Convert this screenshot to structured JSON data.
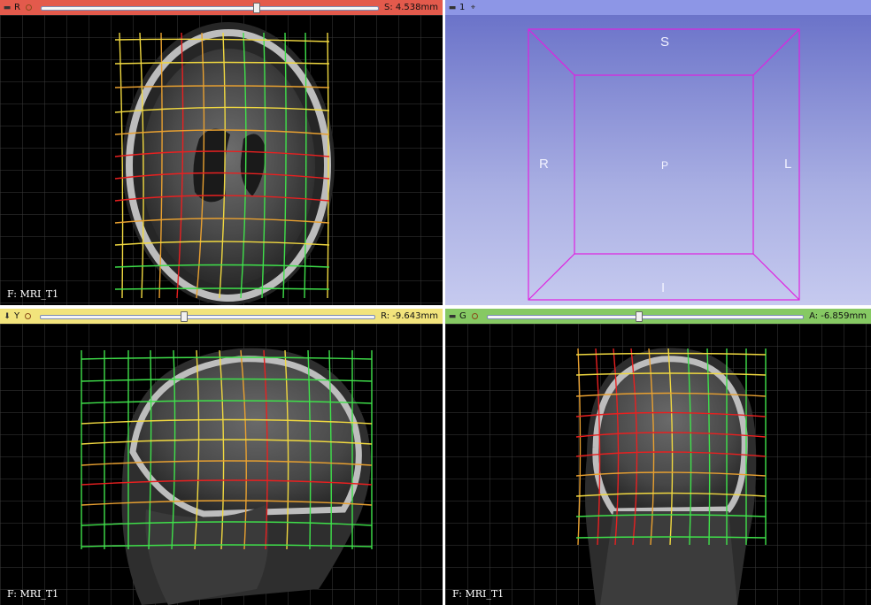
{
  "views": {
    "red": {
      "label": "R",
      "slice_offset": "S: 4.538mm",
      "slider_value": 0.64,
      "foreground": "F: MRI_T1",
      "color": "#e35a4c"
    },
    "threeD": {
      "label": "1",
      "color": "#8d96e6",
      "orientation": {
        "superior": "S",
        "inferior": "I",
        "right": "R",
        "left": "L",
        "posterior": "P"
      }
    },
    "yellow": {
      "label": "Y",
      "slice_offset": "R: -9.643mm",
      "slider_value": 0.43,
      "foreground": "F: MRI_T1",
      "color": "#f2e47c"
    },
    "green": {
      "label": "G",
      "slice_offset": "A: -6.859mm",
      "slider_value": 0.48,
      "foreground": "F: MRI_T1",
      "color": "#86c963"
    }
  },
  "icons": {
    "pin": "pin-icon",
    "link": "link-icon",
    "view_center": "crosshair-icon"
  },
  "colors": {
    "grid_line": "#3b3b3b",
    "warp_low": "#3fe04a",
    "warp_mid": "#f0d840",
    "warp_high": "#e82020",
    "box_outline": "#e020e0"
  }
}
